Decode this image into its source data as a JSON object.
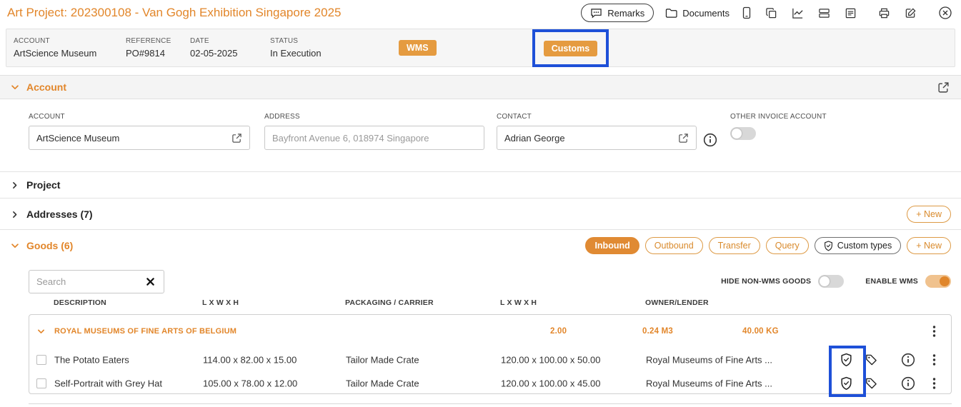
{
  "colors": {
    "accent": "#E0862B",
    "badge": "#E59B40",
    "annotation_blue": "#1E50D8"
  },
  "header": {
    "title": "Art Project: 202300108 - Van Gogh Exhibition Singapore 2025",
    "remarks": "Remarks",
    "documents": "Documents"
  },
  "summary": {
    "fields": [
      {
        "label": "ACCOUNT",
        "value": "ArtScience Museum"
      },
      {
        "label": "REFERENCE",
        "value": "PO#9814"
      },
      {
        "label": "DATE",
        "value": "02-05-2025"
      },
      {
        "label": "STATUS",
        "value": "In Execution"
      }
    ],
    "wms": "WMS",
    "customs": "Customs"
  },
  "account": {
    "title": "Account",
    "account_label": "ACCOUNT",
    "account_value": "ArtScience Museum",
    "address_label": "ADDRESS",
    "address_value": "Bayfront Avenue 6, 018974 Singapore",
    "contact_label": "CONTACT",
    "contact_value": "Adrian George",
    "other_invoice_label": "OTHER INVOICE ACCOUNT"
  },
  "project": {
    "title": "Project"
  },
  "addresses": {
    "title": "Addresses (7)",
    "new_label": "+ New"
  },
  "goods": {
    "title": "Goods (6)",
    "filters": {
      "inbound": "Inbound",
      "outbound": "Outbound",
      "transfer": "Transfer",
      "query": "Query",
      "custom_types": "Custom types",
      "new_label": "+ New"
    },
    "search": {
      "placeholder": "Search"
    },
    "toggles": {
      "hide_non_wms": "HIDE NON-WMS GOODS",
      "enable_wms": "ENABLE WMS"
    },
    "table": {
      "headers": [
        "DESCRIPTION",
        "L X W X H",
        "PACKAGING / CARRIER",
        "L X W X H",
        "OWNER/LENDER"
      ],
      "group": {
        "name": "ROYAL MUSEUMS OF FINE ARTS OF BELGIUM",
        "quantity": "2.00",
        "volume": "0.24 M3",
        "weight": "40.00 KG"
      },
      "rows": [
        {
          "description": "The Potato Eaters",
          "lwh": "114.00 x 82.00 x 15.00",
          "packaging": "Tailor Made Crate",
          "packaging_lwh": "120.00 x 100.00 x 50.00",
          "owner": "Royal Museums of Fine Arts ..."
        },
        {
          "description": "Self-Portrait with Grey Hat",
          "lwh": "105.00 x 78.00 x 12.00",
          "packaging": "Tailor Made Crate",
          "packaging_lwh": "120.00 x 100.00 x 45.00",
          "owner": "Royal Museums of Fine Arts ..."
        }
      ]
    }
  }
}
